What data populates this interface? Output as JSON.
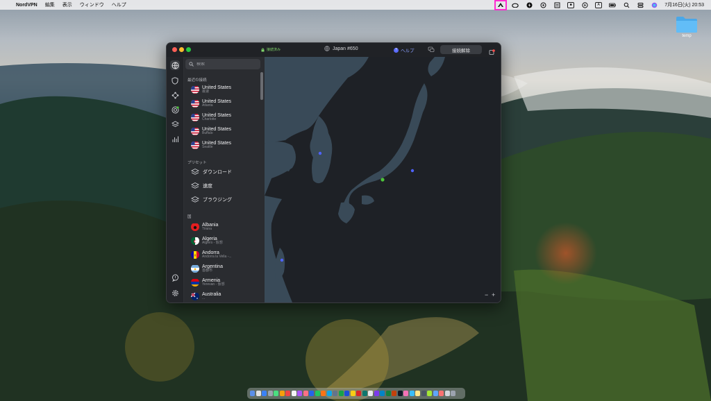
{
  "menubar": {
    "apple_glyph": "",
    "app_name": "NordVPN",
    "menus": [
      "編集",
      "表示",
      "ウィンドウ",
      "ヘルプ"
    ],
    "status_icons": [
      "nordvpn-icon",
      "creative-cloud-icon",
      "bolt-icon",
      "radio-icon",
      "note-icon",
      "battery-box-icon",
      "play-icon",
      "text-a-icon",
      "keyboard-icon",
      "search-icon",
      "control-center-icon",
      "siri-icon"
    ],
    "clock": "7月16日(火)  20:53"
  },
  "desktop": {
    "folder_label": "temp"
  },
  "window": {
    "status_text": "接続済み",
    "server_label": "Japan #650",
    "help_label": "ヘルプ",
    "disconnect_label": "接続解除",
    "search_placeholder": "検索",
    "recent_header": "最近の接続",
    "recent": [
      {
        "country": "United States",
        "city": "最速"
      },
      {
        "country": "United States",
        "city": "Atlanta"
      },
      {
        "country": "United States",
        "city": "Charlotte"
      },
      {
        "country": "United States",
        "city": "Buffalo"
      },
      {
        "country": "United States",
        "city": "Seattle"
      }
    ],
    "presets_header": "プリセット",
    "presets": [
      "ダウンロード",
      "速度",
      "ブラウジング"
    ],
    "countries_header": "国",
    "countries": [
      {
        "country": "Albania",
        "city": "Tirana"
      },
      {
        "country": "Algeria",
        "city": "Algiers - 仮想"
      },
      {
        "country": "Andorra",
        "city": "Andorra la Vella -..."
      },
      {
        "country": "Argentina",
        "city": "首都市"
      },
      {
        "country": "Armenia",
        "city": "Yerevan - 仮想"
      },
      {
        "country": "Australia",
        "city": "..."
      }
    ],
    "zoom_out": "−",
    "zoom_in": "+"
  },
  "colors": {
    "accent_green": "#4cc33a",
    "server_dot": "#4f63ff",
    "help_blue": "#5b6cff",
    "highlight_box": "#ff2bd0"
  }
}
